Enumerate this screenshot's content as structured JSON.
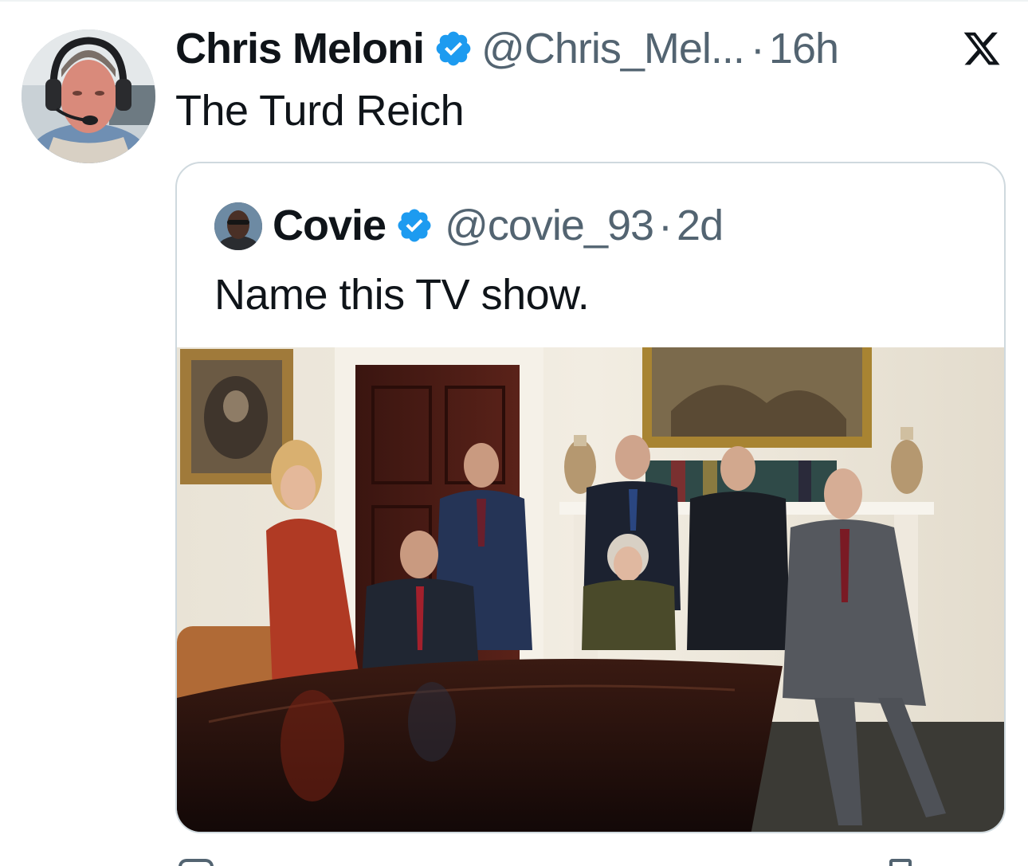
{
  "tweet": {
    "author": {
      "display_name": "Chris Meloni",
      "handle": "@Chris_Mel...",
      "verified": true,
      "avatar_icon": "profile-photo"
    },
    "separator": "·",
    "time": "16h",
    "text": "The Turd Reich",
    "platform_icon": "x-logo-icon"
  },
  "quoted": {
    "author": {
      "display_name": "Covie",
      "handle": "@covie_93",
      "verified": true,
      "avatar_icon": "profile-photo"
    },
    "separator": "·",
    "time": "2d",
    "text": "Name this TV show.",
    "media": {
      "type": "photo",
      "subject": "group-portrait"
    }
  },
  "colors": {
    "text_primary": "#0f1419",
    "text_secondary": "#536471",
    "verified_blue": "#1d9bf0",
    "card_border": "#cfd9de"
  }
}
